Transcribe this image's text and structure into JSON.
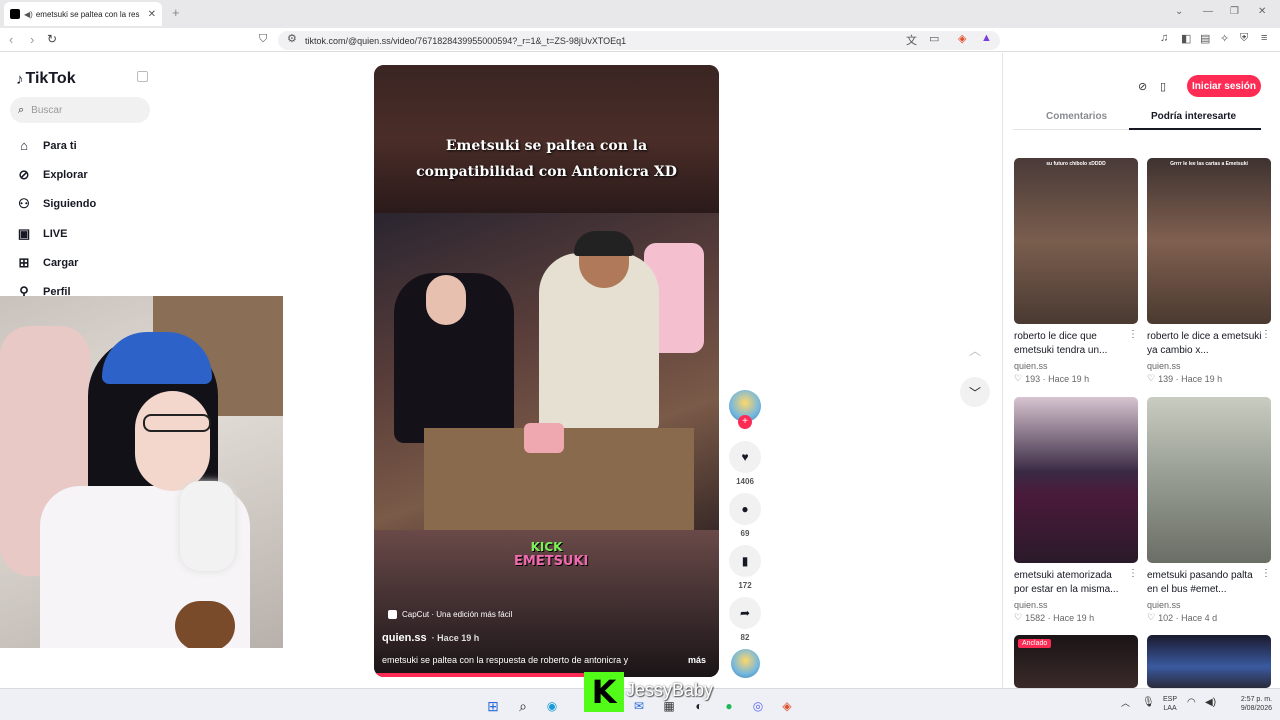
{
  "browser": {
    "tab_title": "emetsuki se paltea con la res",
    "tab_close": "✕",
    "new_tab": "+",
    "url": "tiktok.com/@quien.ss/video/7671828439955000594?_r=1&_t=ZS-98jUvXTOEq1"
  },
  "sidebar": {
    "logo": "TikTok",
    "search_placeholder": "Buscar",
    "items": [
      {
        "label": "Para ti",
        "icon": "home-icon"
      },
      {
        "label": "Explorar",
        "icon": "compass-icon"
      },
      {
        "label": "Siguiendo",
        "icon": "following-icon"
      },
      {
        "label": "LIVE",
        "icon": "live-icon"
      },
      {
        "label": "Cargar",
        "icon": "upload-icon"
      },
      {
        "label": "Perfil",
        "icon": "profile-icon"
      }
    ]
  },
  "video": {
    "caption_line1": "Emetsuki se paltea con la",
    "caption_line2": "compatibilidad con Antonicra XD",
    "overlay_kick": "KICK",
    "overlay_brand": "EMETSUKI",
    "capcut": "CapCut · Una edición más fácil",
    "author": "quien.ss",
    "time": "· Hace 19 h",
    "description": "emetsuki se paltea con la respuesta de roberto de antonicra y",
    "more": "más",
    "progress": 0.62
  },
  "actions": {
    "likes": "1406",
    "comments": "69",
    "saves": "172",
    "shares": "82"
  },
  "right_panel": {
    "login": "Iniciar sesión",
    "tabs": [
      "Comentarios",
      "Podría interesarte"
    ],
    "active_tab": "Podría interesarte",
    "cards": [
      {
        "thumb_text": "su futuro chibolo xDDDD",
        "title": "roberto le dice que emetsuki tendra un...",
        "author": "quien.ss",
        "likes": "193",
        "time": "· Hace 19 h",
        "pinned": ""
      },
      {
        "thumb_text": "Grrrr le lee las cartas a Emetsuki",
        "title": "roberto le dice a emetsuki ya cambio x...",
        "author": "quien.ss",
        "likes": "139",
        "time": "· Hace 19 h",
        "pinned": ""
      },
      {
        "thumb_text": "",
        "title": "emetsuki atemorizada por estar en la misma...",
        "author": "quien.ss",
        "likes": "1582",
        "time": "· Hace 19 h",
        "pinned": ""
      },
      {
        "thumb_text": "",
        "title": "emetsuki pasando palta en el bus #emet...",
        "author": "quien.ss",
        "likes": "102",
        "time": "· Hace 4 d",
        "pinned": ""
      },
      {
        "thumb_text": "",
        "title": "",
        "author": "",
        "likes": "",
        "time": "",
        "pinned": "Anclado"
      }
    ]
  },
  "stream_overlay": {
    "kick_letter": "K",
    "streamer": "JessyBaby"
  },
  "taskbar": {
    "lang": "ESP",
    "lang2": "LAA",
    "time": "2:57 p. m.",
    "date": "9/08/2026"
  }
}
